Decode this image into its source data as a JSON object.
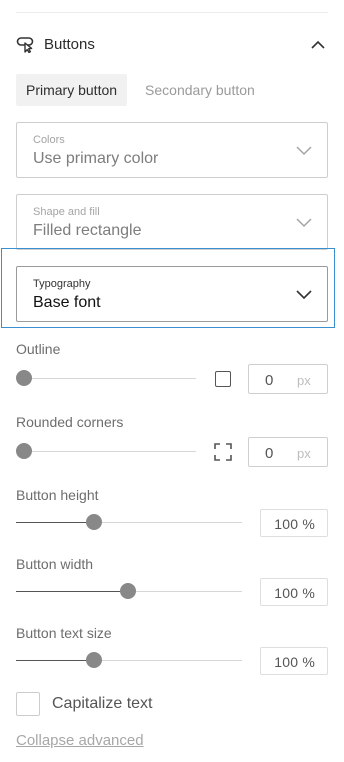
{
  "section": {
    "title": "Buttons",
    "icon": "button-cursor-icon",
    "toggle_icon": "chevron-up-icon"
  },
  "tabs": [
    {
      "label": "Primary button",
      "active": true
    },
    {
      "label": "Secondary button",
      "active": false
    }
  ],
  "colors_select": {
    "label": "Colors",
    "value": "Use primary color"
  },
  "shape_select": {
    "label": "Shape and fill",
    "value": "Filled rectangle"
  },
  "typography_select": {
    "label": "Typography",
    "value": "Base font"
  },
  "outline": {
    "label": "Outline",
    "value": "0",
    "unit": "px",
    "slider_level": 0
  },
  "rounded": {
    "label": "Rounded corners",
    "value": "0",
    "unit": "px",
    "slider_level": 0
  },
  "height": {
    "label": "Button height",
    "value": "100 %",
    "slider_level": 0.35
  },
  "width": {
    "label": "Button width",
    "value": "100 %",
    "slider_level": 0.5
  },
  "text_size": {
    "label": "Button text size",
    "value": "100 %",
    "slider_level": 0.35
  },
  "capitalize": {
    "label": "Capitalize text",
    "checked": false
  },
  "collapse_link": "Collapse advanced",
  "colors": {
    "focus": "#3a8fd0",
    "knob": "#888888"
  }
}
